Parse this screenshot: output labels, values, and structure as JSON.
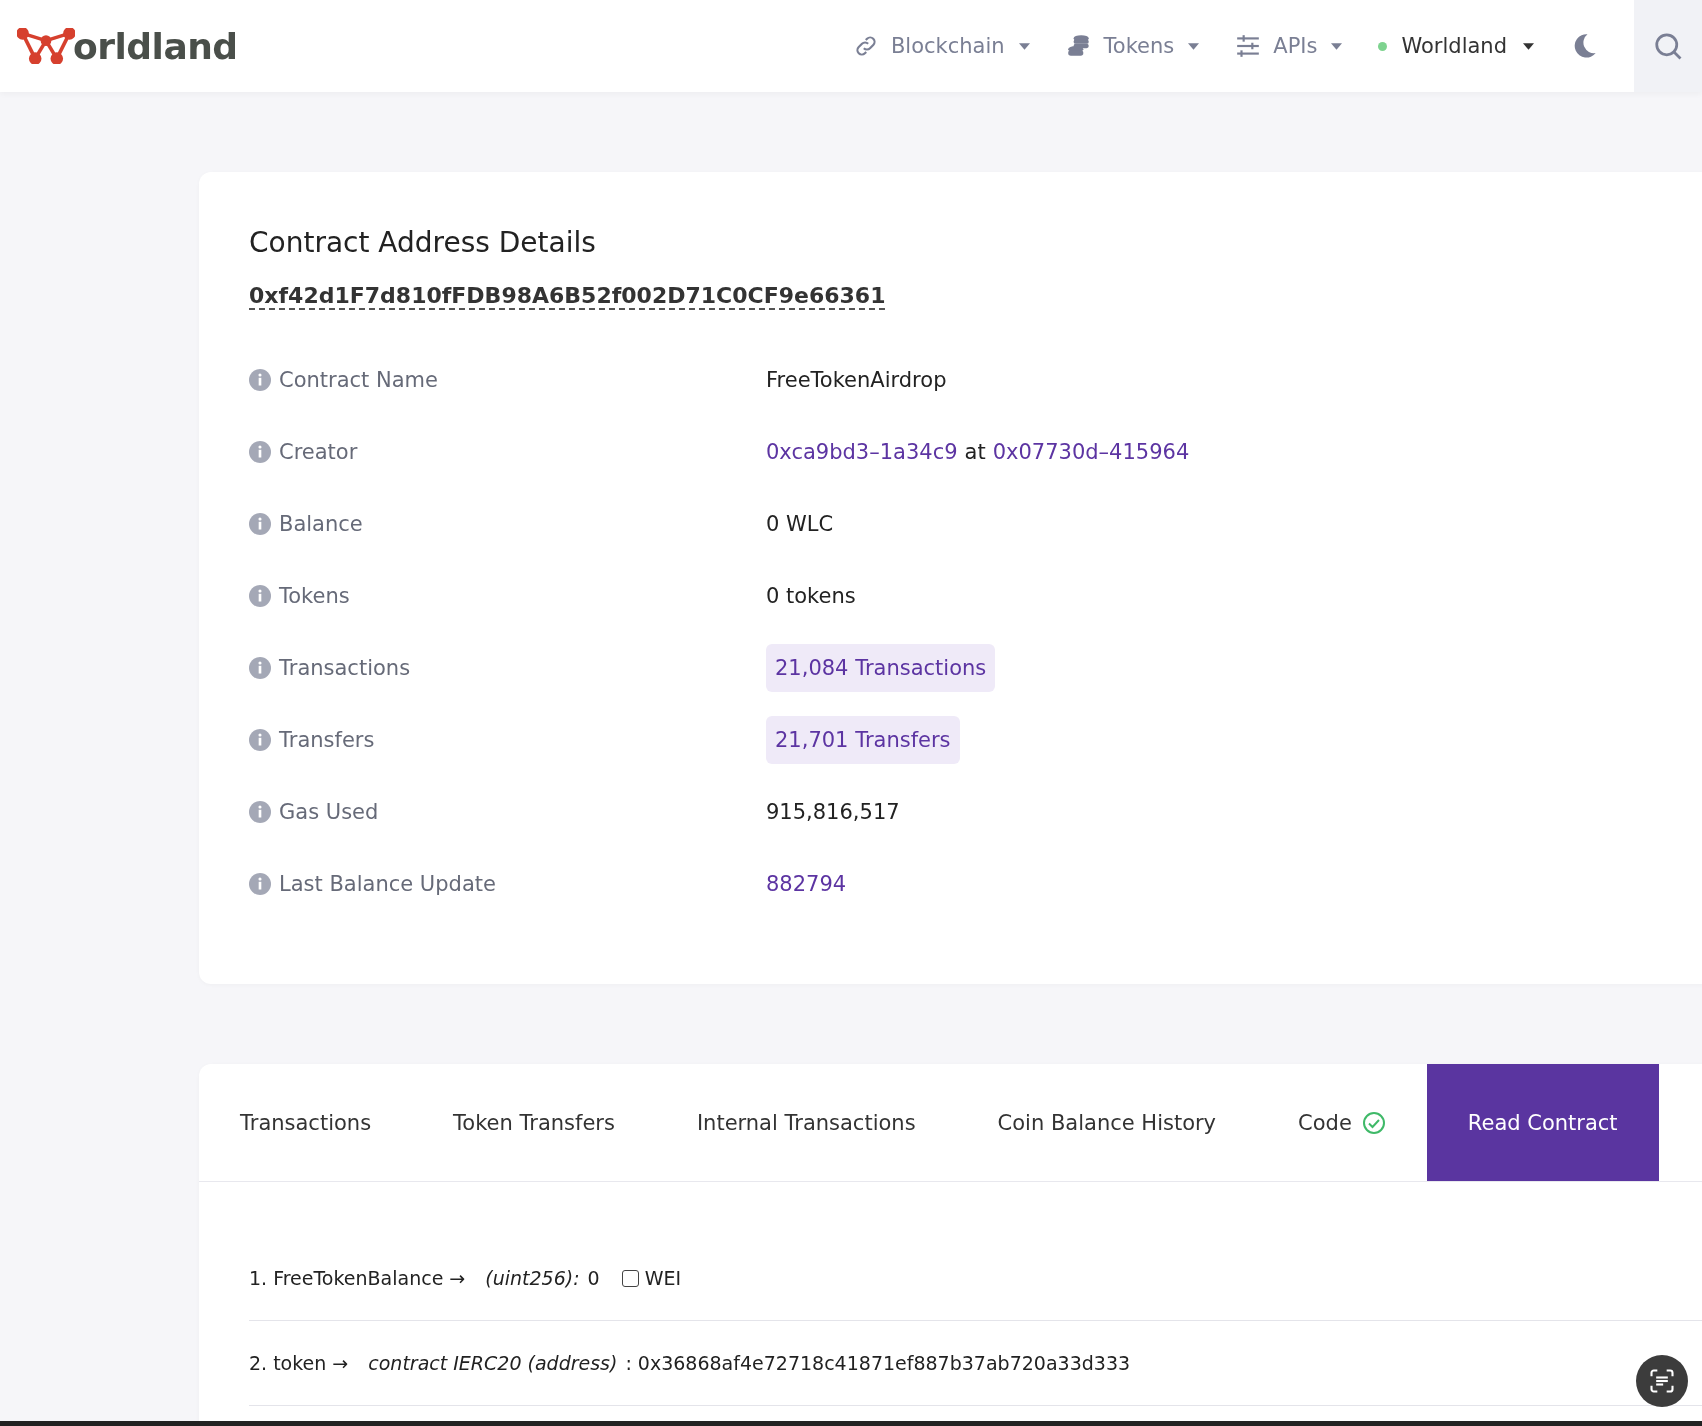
{
  "header": {
    "logo": "orldland",
    "nav": [
      {
        "label": "Blockchain",
        "kind": "chain"
      },
      {
        "label": "Tokens",
        "kind": "coins"
      },
      {
        "label": "APIs",
        "kind": "sliders"
      },
      {
        "label": "Worldland",
        "kind": "network"
      }
    ]
  },
  "details": {
    "title": "Contract Address Details",
    "address": "0xf42d1F7d810fFDB98A6B52f002D71C0CF9e66361",
    "rows": [
      {
        "label": "Contract Name",
        "kind": "text",
        "value": "FreeTokenAirdrop"
      },
      {
        "label": "Creator",
        "kind": "creator",
        "creator": "0xca9bd3–1a34c9",
        "at": "at",
        "tx": "0x07730d–415964"
      },
      {
        "label": "Balance",
        "kind": "text",
        "value": "0 WLC"
      },
      {
        "label": "Tokens",
        "kind": "text",
        "value": "0 tokens"
      },
      {
        "label": "Transactions",
        "kind": "badge",
        "value": "21,084 Transactions"
      },
      {
        "label": "Transfers",
        "kind": "badge",
        "value": "21,701 Transfers"
      },
      {
        "label": "Gas Used",
        "kind": "text",
        "value": "915,816,517"
      },
      {
        "label": "Last Balance Update",
        "kind": "link",
        "value": "882794"
      }
    ]
  },
  "tabs": [
    {
      "label": "Transactions",
      "selected": false,
      "verified": false
    },
    {
      "label": "Token Transfers",
      "selected": false,
      "verified": false
    },
    {
      "label": "Internal Transactions",
      "selected": false,
      "verified": false
    },
    {
      "label": "Coin Balance History",
      "selected": false,
      "verified": false
    },
    {
      "label": "Code",
      "selected": false,
      "verified": true
    },
    {
      "label": "Read Contract",
      "selected": true,
      "verified": false
    }
  ],
  "read_rows": [
    {
      "index": "1.",
      "name": "FreeTokenBalance",
      "arrow": "→",
      "type": "(uint256):",
      "value": "0",
      "unit": {
        "label": "WEI",
        "checked": false
      }
    },
    {
      "index": "2.",
      "name": "token",
      "arrow": "→",
      "type": "contract IERC20 (address)",
      "value": ": 0x36868af4e72718c41871ef887b37ab720a33d333"
    }
  ]
}
